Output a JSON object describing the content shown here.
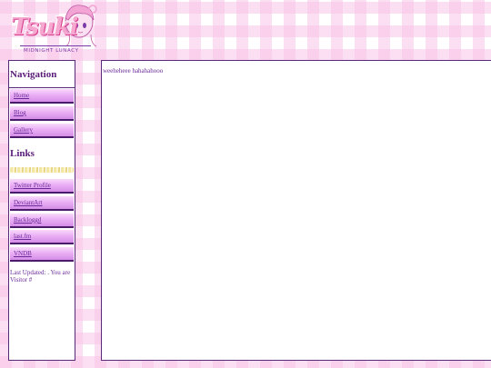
{
  "header": {
    "logo_title": "Tsuki",
    "logo_subtitle": "MIDNIGHT LUNACY"
  },
  "sidebar": {
    "navigation_heading": "Navigation",
    "navigation_items": [
      {
        "label": "Home"
      },
      {
        "label": "Blog"
      },
      {
        "label": "Gallery"
      }
    ],
    "links_heading": "Links",
    "link_items": [
      {
        "label": "Twitter Profile"
      },
      {
        "label": "DeviantArt"
      },
      {
        "label": "Backloggd"
      },
      {
        "label": "last.fm"
      },
      {
        "label": "VNDB"
      }
    ],
    "status_text": "Last Updated: . You are Visitor #"
  },
  "main": {
    "body_text": "weeheheee hahahahooo"
  },
  "colors": {
    "accent_purple": "#5a1a7a",
    "button_pink": "#eab0f4",
    "gingham_pink": "#f8c4e8",
    "panel_background": "#ffffff"
  },
  "icons": {
    "logo_character": "anime-girl-mascot-icon",
    "divider": "sparkle-divider-icon"
  }
}
